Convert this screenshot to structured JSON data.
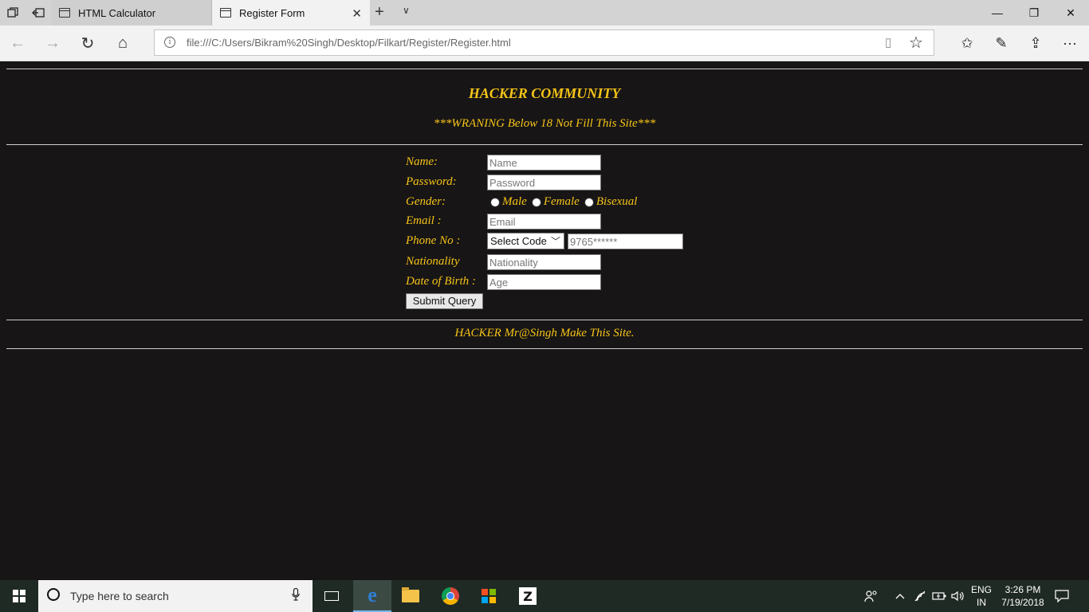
{
  "browser": {
    "tabs": [
      {
        "label": "HTML Calculator",
        "active": false
      },
      {
        "label": "Register Form",
        "active": true
      }
    ],
    "url": "file:///C:/Users/Bikram%20Singh/Desktop/Filkart/Register/Register.html",
    "icons": {
      "tab_actions": "tab-actions-icon",
      "set_aside": "set-aside-tabs-icon",
      "new_tab": "+",
      "tab_menu": "∨",
      "minimize": "—",
      "maximize": "❐",
      "close": "✕",
      "tab_close": "✕",
      "back": "←",
      "forward": "→",
      "refresh": "↻",
      "home": "⌂",
      "reading_view": "▯",
      "favorite": "☆",
      "favorites_hub": "✩",
      "notes": "✎",
      "share": "⇪",
      "more": "···"
    }
  },
  "page": {
    "title": "HACKER COMMUNITY",
    "warning": "***WRANING Below 18 Not Fill This Site***",
    "form": {
      "name_label": "Name:",
      "name_placeholder": "Name",
      "password_label": "Password:",
      "password_placeholder": "Password",
      "gender_label": "Gender:",
      "gender_options": [
        "Male",
        "Female",
        "Bisexual"
      ],
      "email_label": "Email :",
      "email_placeholder": "Email",
      "phone_label": "Phone No :",
      "phone_code_selected": "Select Code",
      "phone_placeholder": "9765******",
      "nationality_label": "Nationality",
      "nationality_placeholder": "Nationality",
      "dob_label": "Date of Birth :",
      "dob_placeholder": "Age",
      "submit_label": "Submit Query"
    },
    "footer": "HACKER Mr@Singh Make This Site.",
    "colors": {
      "background": "#171516",
      "text": "#f6c417",
      "rule": "#cfcfcf"
    }
  },
  "taskbar": {
    "search_placeholder": "Type here to search",
    "apps": [
      "task-view",
      "microsoft-edge",
      "file-explorer",
      "google-chrome",
      "microsoft-store",
      "zapp"
    ],
    "language_top": "ENG",
    "language_bottom": "IN",
    "time": "3:26 PM",
    "date": "7/19/2018"
  }
}
